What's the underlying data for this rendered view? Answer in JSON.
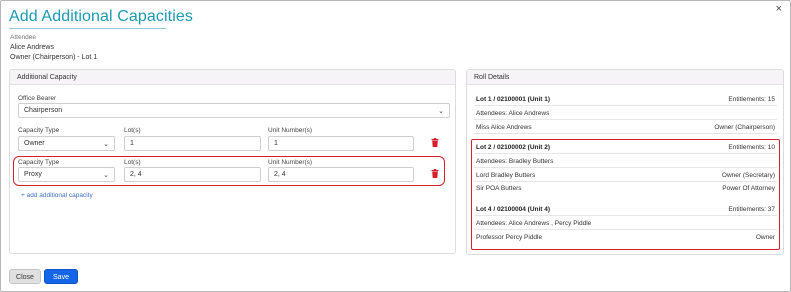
{
  "dialog": {
    "title": "Add Additional Capacities",
    "close_icon": "×"
  },
  "attendee": {
    "label": "Attendee",
    "name": "Alice Andrews",
    "role": "Owner (Chairperson) - Lot 1"
  },
  "additional_capacity": {
    "header": "Additional Capacity",
    "office_bearer_label": "Office Bearer",
    "office_bearer_value": "Chairperson",
    "rows": [
      {
        "capacity_type_label": "Capacity Type",
        "capacity_type_value": "Owner",
        "lots_label": "Lot(s)",
        "lots_value": "1",
        "units_label": "Unit Number(s)",
        "units_value": "1"
      },
      {
        "capacity_type_label": "Capacity Type",
        "capacity_type_value": "Proxy",
        "lots_label": "Lot(s)",
        "lots_value": "2, 4",
        "units_label": "Unit Number(s)",
        "units_value": "2, 4"
      }
    ],
    "add_link": "+ add additional capacity"
  },
  "roll_details": {
    "header": "Roll Details",
    "lots": [
      {
        "title": "Lot 1 / 02100001 (Unit 1)",
        "entitlements": "Entitlements: 15",
        "attendees": "Attendees: Alice Andrews",
        "people": [
          {
            "name": "Miss Alice Andrews",
            "role": "Owner (Chairperson)"
          }
        ]
      },
      {
        "title": "Lot 2 / 02100002 (Unit 2)",
        "entitlements": "Entitlements: 10",
        "attendees": "Attendees: Bradley Butters",
        "people": [
          {
            "name": "Lord Bradley Butters",
            "role": "Owner (Secretary)"
          },
          {
            "name": "Sir POA Butters",
            "role": "Power Of Attorney"
          }
        ]
      },
      {
        "title": "Lot 4 / 02100004 (Unit 4)",
        "entitlements": "Entitlements: 37",
        "attendees": "Attendees: Alice Andrews , Percy Piddle",
        "people": [
          {
            "name": "Professor Percy Piddle",
            "role": "Owner"
          }
        ]
      }
    ]
  },
  "footer": {
    "close_label": "Close",
    "save_label": "Save"
  },
  "colors": {
    "title": "#1a9bb0",
    "highlight": "#d6202a",
    "save_button": "#1565e8",
    "link": "#3b6fc8",
    "trash": "#d6202a"
  },
  "icons": {
    "dialog_close": "close-icon",
    "select_caret": "chevron-down-icon",
    "delete": "trash-icon"
  }
}
